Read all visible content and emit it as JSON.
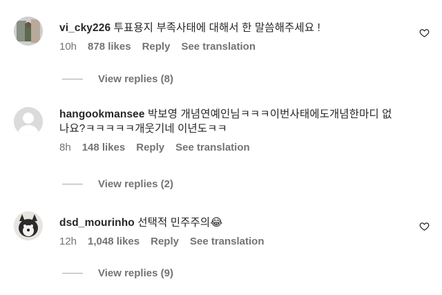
{
  "comments": [
    {
      "username": "vi_cky226",
      "text": "투표용지 부족사태에 대해서 한 말씀해주세요 !",
      "time": "10h",
      "likes": "878 likes",
      "reply": "Reply",
      "translate": "See translation",
      "view_replies": "View replies (8)",
      "avatar": "photo"
    },
    {
      "username": "hangookmansee",
      "text": "박보영 개념연예인님ㅋㅋㅋ이번사태에도개념한마디 없나요?ㅋㅋㅋㅋㅋ개웃기네 이년도ㅋㅋ",
      "time": "8h",
      "likes": "148 likes",
      "reply": "Reply",
      "translate": "See translation",
      "view_replies": "View replies (2)",
      "avatar": "default-user"
    },
    {
      "username": "dsd_mourinho",
      "text": "선택적 민주주의😂",
      "time": "12h",
      "likes": "1,048 likes",
      "reply": "Reply",
      "translate": "See translation",
      "view_replies": "View replies (9)",
      "avatar": "dog-photo"
    }
  ],
  "colors": {
    "text": "#262626",
    "secondary": "#737373",
    "line": "#a8a8a8"
  }
}
